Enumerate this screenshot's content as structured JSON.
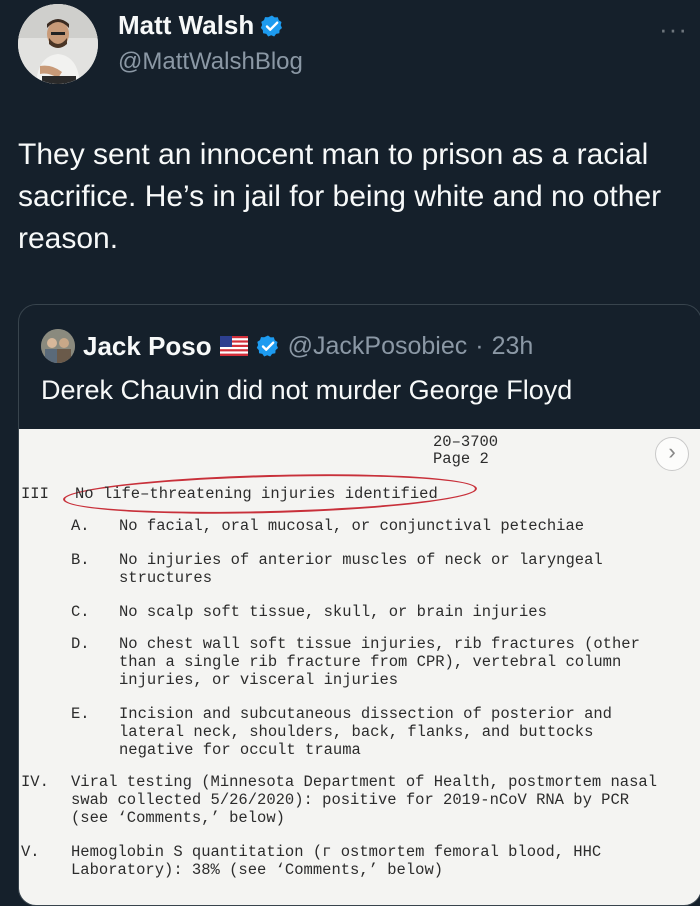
{
  "tweet": {
    "author_name": "Matt Walsh",
    "author_handle": "@MattWalshBlog",
    "more_label": "···",
    "text": "They sent an innocent man to prison as a racial sacrifice. He’s in jail for being white and no other reason."
  },
  "quoted": {
    "author_name": "Jack Poso",
    "author_handle": "@JackPosobiec",
    "separator": "·",
    "time": "23h",
    "text": "Derek Chauvin did not murder George Floyd",
    "document": {
      "case_number": "20–3700",
      "page": "Page 2",
      "section3_numeral": "III",
      "section3_title": "No life–threatening injuries identified",
      "items": [
        {
          "letter": "A.",
          "lines": [
            "No facial, oral mucosal, or conjunctival petechiae"
          ]
        },
        {
          "letter": "B.",
          "lines": [
            "No injuries of anterior muscles of neck or laryngeal",
            "structures"
          ]
        },
        {
          "letter": "C.",
          "lines": [
            "No scalp soft tissue, skull, or brain injuries"
          ]
        },
        {
          "letter": "D.",
          "lines": [
            "No chest wall soft tissue injuries, rib fractures (other",
            "than a single rib fracture from CPR), vertebral column",
            "injuries, or visceral injuries"
          ]
        },
        {
          "letter": "E.",
          "lines": [
            "Incision and subcutaneous dissection of posterior and",
            "lateral neck, shoulders, back, flanks, and buttocks",
            "negative for occult trauma"
          ]
        }
      ],
      "section4_numeral": "IV.",
      "section4_lines": [
        "Viral testing (Minnesota Department of Health, postmortem nasal",
        "swab collected 5/26/2020): positive for 2019-nCoV RNA by PCR",
        "(see ‘Comments,’ below)"
      ],
      "section5_numeral": "V.",
      "section5_lines": [
        "Hemoglobin S quantitation (г ostmortem femoral blood, HHC",
        "Laboratory): 38% (see ‘Comments,’ below)"
      ]
    }
  },
  "icons": {
    "verified_color": "#1d9bf0",
    "annotation_color": "#c8303a"
  }
}
